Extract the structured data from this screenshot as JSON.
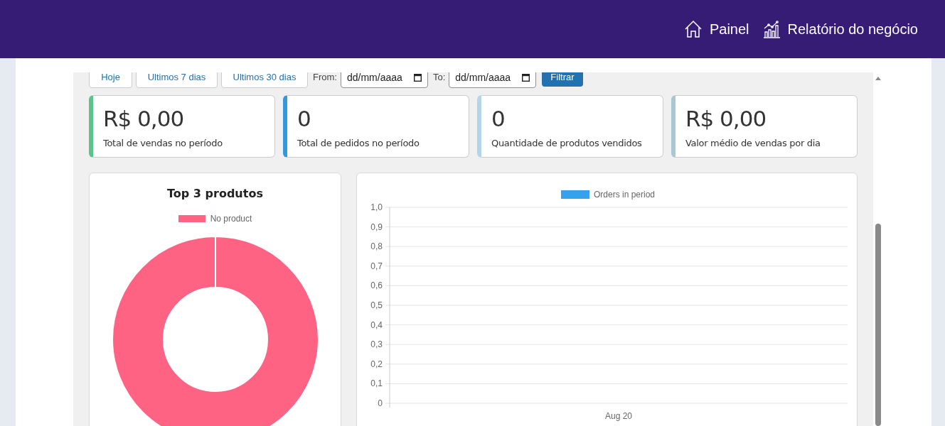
{
  "nav": [
    {
      "kind": "home",
      "label": "Painel"
    },
    {
      "kind": "report",
      "label": "Relatório do negócio"
    }
  ],
  "filters": {
    "presets": [
      "Hoje",
      "Ultimos 7 dias",
      "Ultimos 30 dias"
    ],
    "from": {
      "label": "From:",
      "placeholder": "dd/mm/aaaa"
    },
    "to": {
      "label": "To:",
      "placeholder": "dd/mm/aaaa"
    },
    "submit": "Filtrar"
  },
  "stats": [
    {
      "value": "R$ 0,00",
      "label": "Total de vendas no período",
      "color": "#5cc489"
    },
    {
      "value": "0",
      "label": "Total de pedidos no período",
      "color": "#3598db"
    },
    {
      "value": "0",
      "label": "Quantidade de produtos vendidos",
      "color": "#b3d4ea"
    },
    {
      "value": "R$ 0,00",
      "label": "Valor médio de vendas por dia",
      "color": "#a9c8d4"
    }
  ],
  "top_products": {
    "title": "Top 3 produtos",
    "chart_data": {
      "type": "donut",
      "categories": [
        "No product"
      ],
      "series": [
        {
          "color": "#ff6384",
          "values": [
            1
          ]
        }
      ]
    }
  },
  "orders": {
    "chart_data": {
      "type": "line",
      "grid": true,
      "categories": [
        "Aug 20"
      ],
      "ylim": [
        0,
        1
      ],
      "yticks": [
        {
          "value": 0,
          "label": "0"
        },
        {
          "value": 0.1,
          "label": "0,1"
        },
        {
          "value": 0.2,
          "label": "0,2"
        },
        {
          "value": 0.3,
          "label": "0,3"
        },
        {
          "value": 0.4,
          "label": "0,4"
        },
        {
          "value": 0.5,
          "label": "0,5"
        },
        {
          "value": 0.6,
          "label": "0,6"
        },
        {
          "value": 0.7,
          "label": "0,7"
        },
        {
          "value": 0.8,
          "label": "0,8"
        },
        {
          "value": 0.9,
          "label": "0,9"
        },
        {
          "value": 1,
          "label": "1,0"
        }
      ],
      "series": [
        {
          "name": "Orders in period",
          "color": "#36a2eb",
          "values": [
            null
          ]
        }
      ]
    }
  }
}
